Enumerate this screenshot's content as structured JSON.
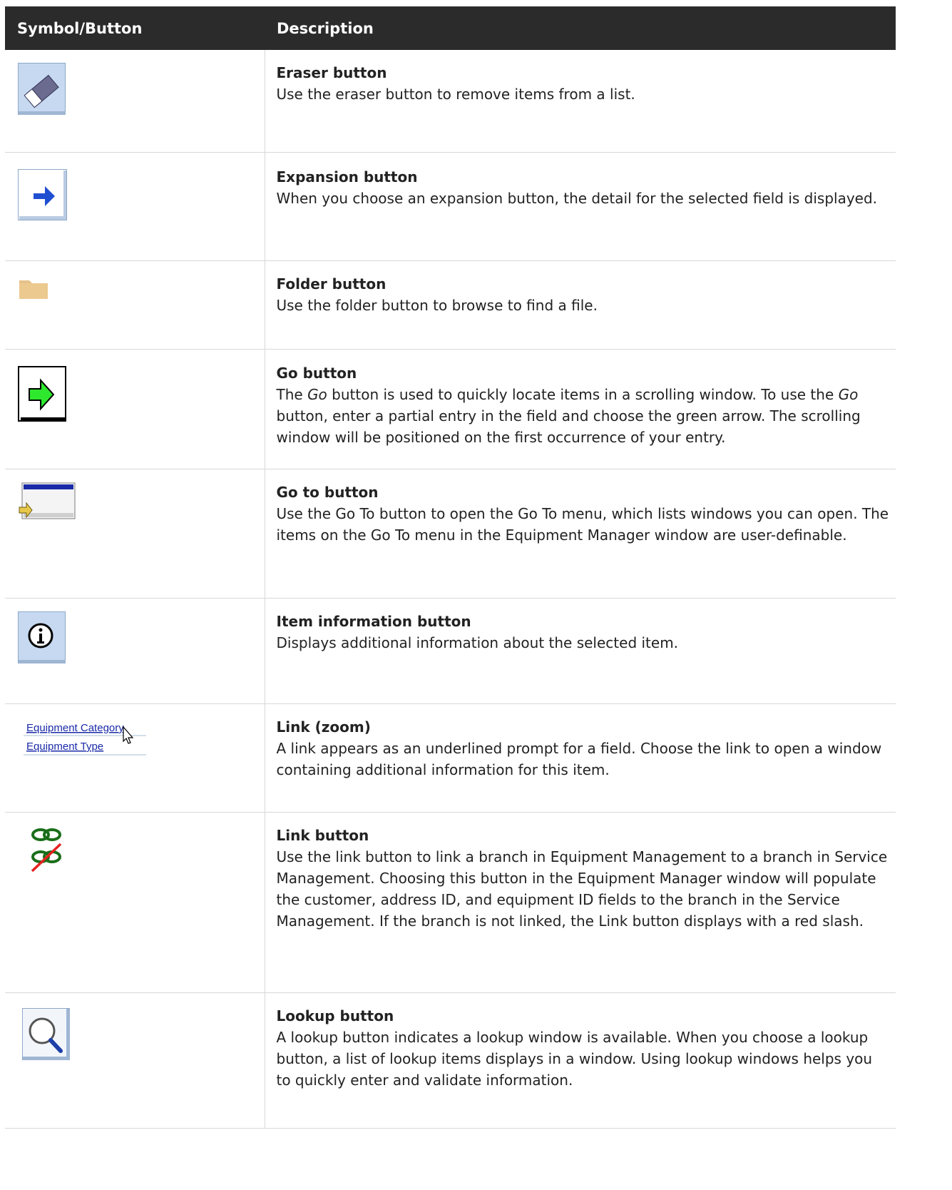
{
  "header": {
    "col1": "Symbol/Button",
    "col2": "Description"
  },
  "rows": [
    {
      "title": "Eraser button",
      "desc": "Use the eraser button to remove items from a list.",
      "icon": "eraser-icon"
    },
    {
      "title": "Expansion button",
      "desc": "When you choose an expansion button, the detail for the selected field is displayed.",
      "icon": "expansion-arrow-icon"
    },
    {
      "title": "Folder button",
      "desc": "Use the folder button to browse to find a file.",
      "icon": "folder-icon"
    },
    {
      "title": "Go button",
      "desc_parts": [
        "The ",
        "Go",
        " button is used to quickly locate items in a scrolling window. To use the ",
        "Go",
        " button, enter a partial entry in the field and choose the green arrow. The scrolling window will be positioned on the first occurrence of your entry."
      ],
      "icon": "go-arrow-icon"
    },
    {
      "title": "Go to button",
      "desc": "Use the Go To button to open the Go To menu, which lists windows you can open. The items on the Go To menu in the Equipment Manager window are user-definable.",
      "icon": "go-to-icon"
    },
    {
      "title": "Item information button",
      "desc": "Displays additional information about the selected item.",
      "icon": "info-icon"
    },
    {
      "title": "Link (zoom)",
      "desc": "A link appears as an underlined prompt for a field. Choose the link to open a window containing additional information for this item.",
      "icon": "zoom-link-image",
      "sample_links": [
        "Equipment Category",
        "Equipment Type"
      ]
    },
    {
      "title": "Link button",
      "desc": "Use the link button to link a branch in Equipment Management to a branch in Service Management. Choosing this button in the Equipment Manager window will populate the customer, address ID, and equipment ID fields to the branch in the Service Management. If the branch is not linked, the Link button displays with a red slash.",
      "icon": "chain-link-icon"
    },
    {
      "title": "Lookup button",
      "desc": "A lookup button indicates a lookup window is available. When you choose a lookup button, a list of lookup items displays in a window. Using lookup windows helps you to quickly enter and validate information.",
      "icon": "lookup-magnifier-icon"
    }
  ]
}
